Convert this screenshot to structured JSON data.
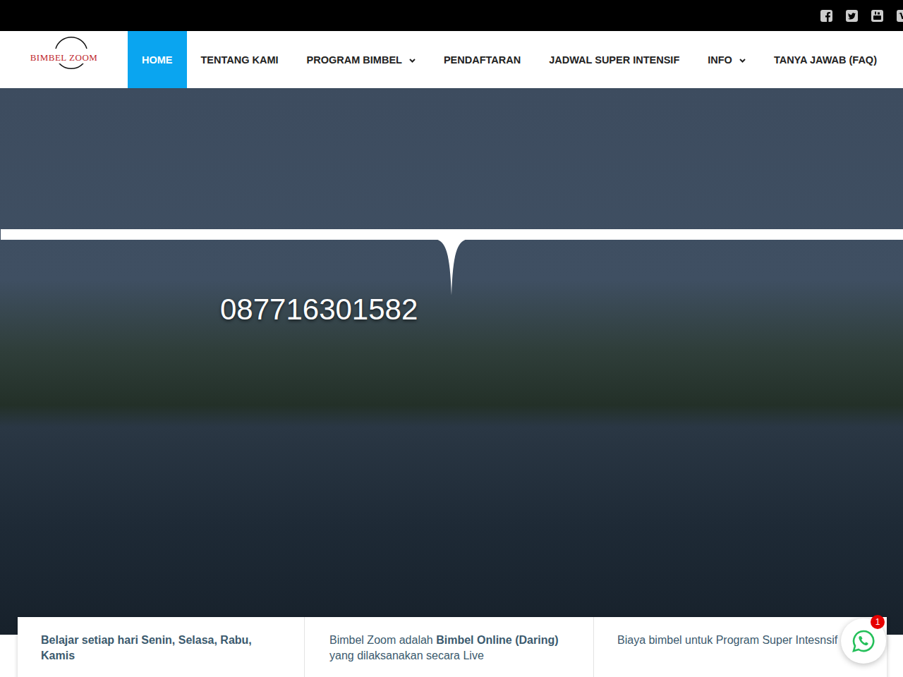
{
  "logo": {
    "text": "BIMBEL ZOOM"
  },
  "social_links": [
    "facebook",
    "twitter",
    "youtube",
    "vimeo"
  ],
  "nav": {
    "items": [
      {
        "label": "HOME",
        "selected": true,
        "dropdown": false
      },
      {
        "label": "TENTANG KAMI",
        "selected": false,
        "dropdown": false
      },
      {
        "label": "PROGRAM BIMBEL",
        "selected": false,
        "dropdown": true
      },
      {
        "label": "PENDAFTARAN",
        "selected": false,
        "dropdown": false
      },
      {
        "label": "JADWAL SUPER INTENSIF",
        "selected": false,
        "dropdown": false
      },
      {
        "label": "INFO",
        "selected": false,
        "dropdown": true
      },
      {
        "label": "TANYA JAWAB (FAQ)",
        "selected": false,
        "dropdown": false
      }
    ]
  },
  "hero": {
    "phone": "087716301582"
  },
  "cards": [
    {
      "segments": [
        {
          "text": "Belajar setiap hari Senin, Selasa, Rabu, Kamis",
          "bold": true
        }
      ]
    },
    {
      "segments": [
        {
          "text": "Bimbel Zoom adalah ",
          "bold": false
        },
        {
          "text": "Bimbel Online (Daring)",
          "bold": true
        },
        {
          "text": " yang dilaksanakan secara Live",
          "bold": false
        }
      ]
    },
    {
      "segments": [
        {
          "text": "Biaya bimbel untuk Program Super Intesnsif",
          "bold": false
        }
      ]
    }
  ],
  "whatsapp": {
    "badge": "1"
  }
}
